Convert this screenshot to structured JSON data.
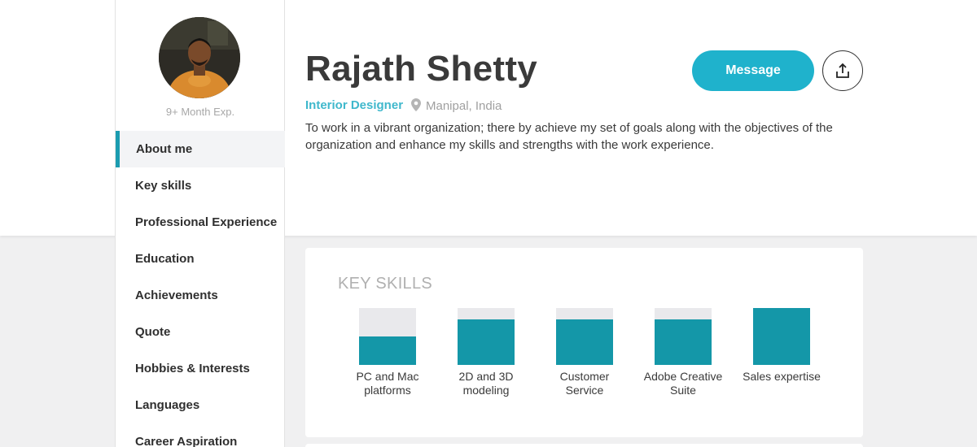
{
  "profile": {
    "name": "Rajath Shetty",
    "role": "Interior Designer",
    "location": "Manipal, India",
    "experience": "9+ Month Exp.",
    "about": "To work in a vibrant organization; there by achieve my set of goals along with the objectives of the organization and enhance my skills and strengths with the work experience."
  },
  "actions": {
    "message_label": "Message",
    "share_icon": "share-icon"
  },
  "sidebar": {
    "items": [
      {
        "label": "About me",
        "active": true
      },
      {
        "label": "Key skills"
      },
      {
        "label": "Professional Experience"
      },
      {
        "label": "Education"
      },
      {
        "label": "Achievements"
      },
      {
        "label": "Quote"
      },
      {
        "label": "Hobbies & Interests"
      },
      {
        "label": "Languages"
      },
      {
        "label": "Career Aspiration"
      }
    ]
  },
  "key_skills": {
    "title": "KEY SKILLS",
    "items": [
      {
        "label": "PC and Mac platforms",
        "level": 0.5
      },
      {
        "label": "2D and 3D modeling",
        "level": 0.8
      },
      {
        "label": "Customer Service",
        "level": 0.8
      },
      {
        "label": "Adobe Creative Suite",
        "level": 0.8
      },
      {
        "label": "Sales expertise",
        "level": 1.0
      }
    ]
  },
  "colors": {
    "accent": "#1fb2cc",
    "skill_fill": "#1497a8",
    "skill_track": "#e9e9ec"
  }
}
